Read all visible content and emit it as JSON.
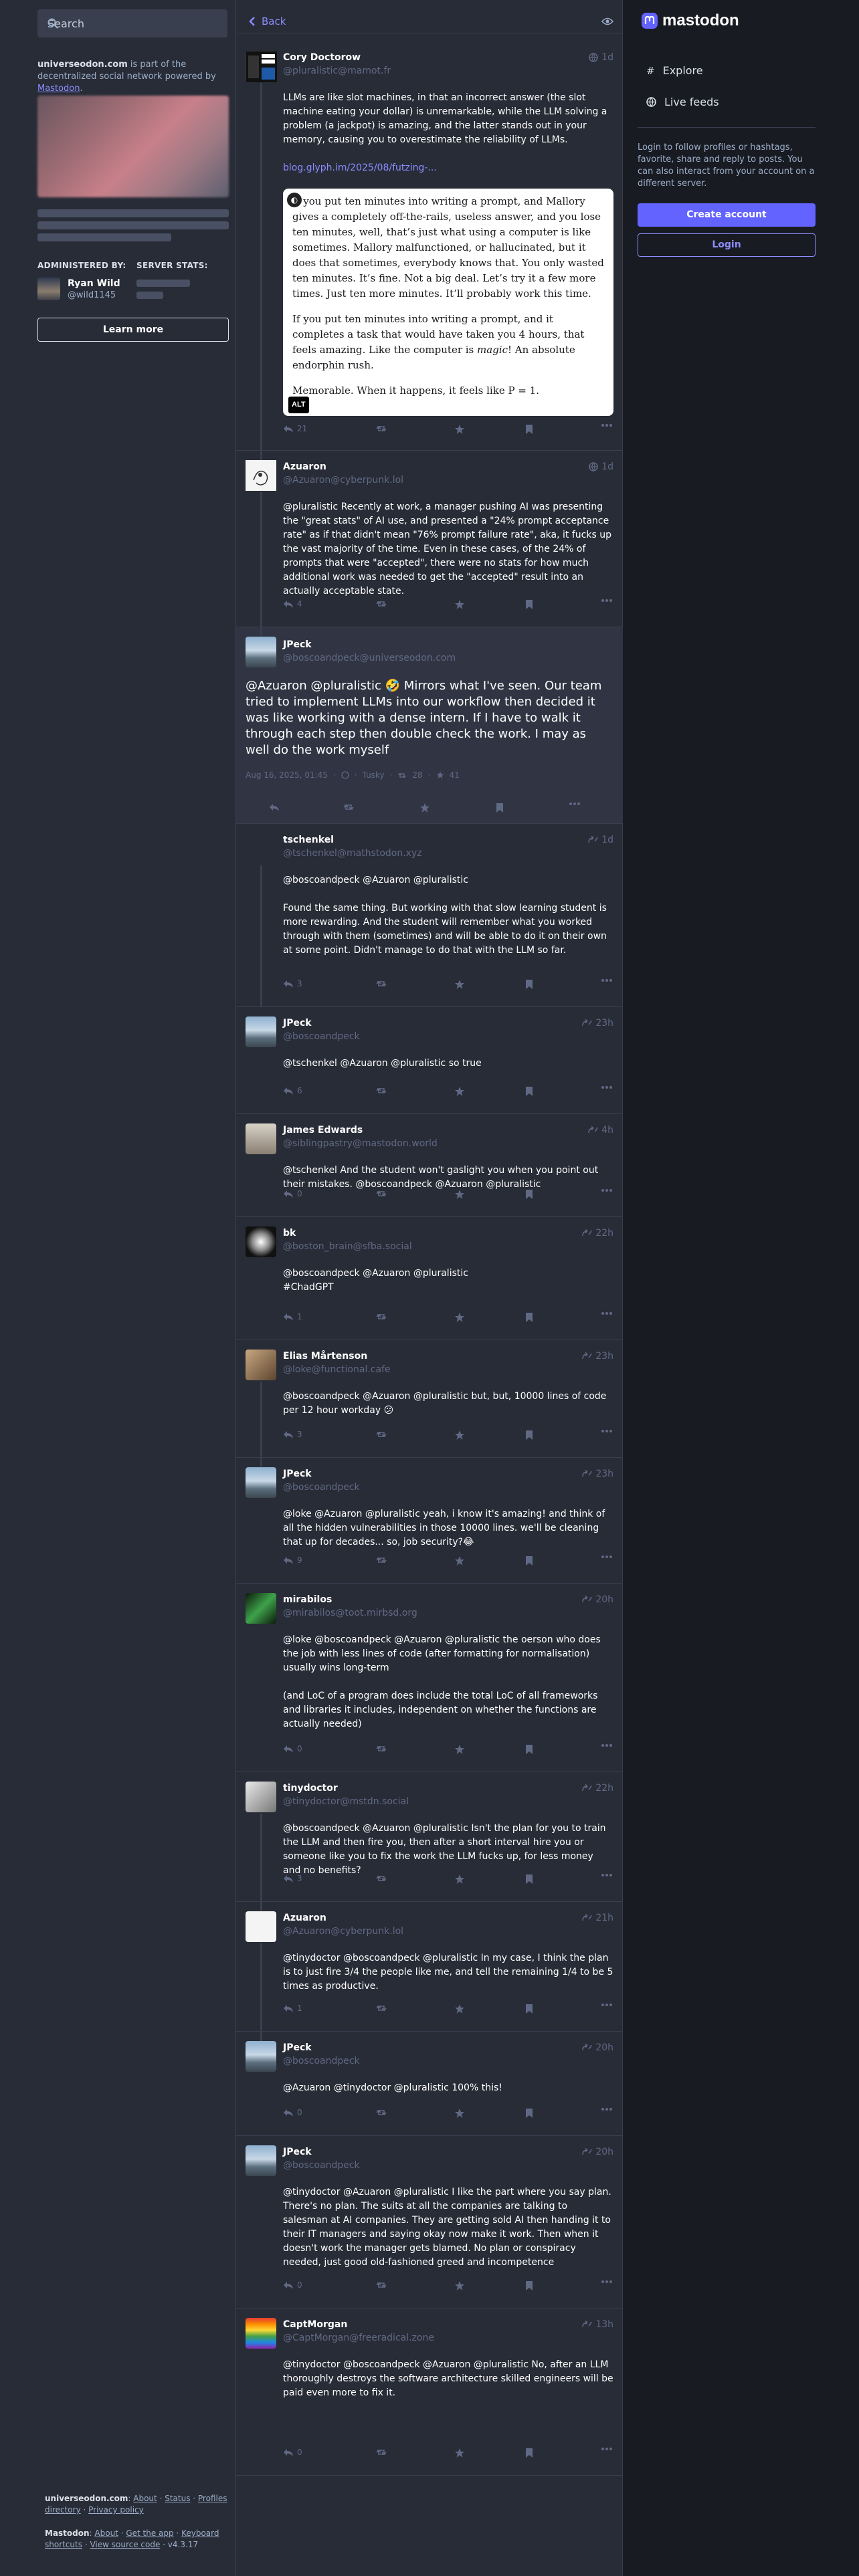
{
  "sidebar": {
    "search_placeholder": "Search",
    "about_domain": "universeodon.com",
    "about_text": " is part of the decentralized social network powered by ",
    "about_link": "Mastodon",
    "administered_by": "ADMINISTERED BY:",
    "server_stats": "SERVER STATS:",
    "admin_name": "Ryan Wild",
    "admin_acct": "@wild1145",
    "learn_more": "Learn more",
    "footer": {
      "domain": "universeodon.com",
      "links1": [
        "About",
        "Status",
        "Profiles directory",
        "Privacy policy"
      ],
      "mastodon": "Mastodon",
      "links2": [
        "About",
        "Get the app",
        "Keyboard shortcuts",
        "View source code"
      ],
      "version": "v4.3.17"
    }
  },
  "header": {
    "back": "Back"
  },
  "posts": [
    {
      "name": "Cory Doctorow",
      "acct": "@pluralistic@mamot.fr",
      "time": "1d",
      "text": "LLMs are like slot machines, in that an incorrect answer (the slot machine eating your dollar) is unremarkable, while the LLM solving a problem (a jackpot) is amazing, and the latter stands out in your memory, causing you to overestimate the reliability of LLMs.",
      "link": "blog.glyph.im/2025/08/futzing-...",
      "card_p1": "If you put ten minutes into writing a prompt, and Mallory gives a completely off-the-rails, useless answer, and you lose ten minutes, well, that’s just what using a computer is like sometimes. Mallory malfunctioned, or hallucinated, but it does that sometimes, everybody knows that. You only wasted ten minutes. It’s fine. Not a big deal. Let’s try it a few more times. Just ten more minutes. It’ll probably work this time.",
      "card_p2a": "If you put ten minutes into writing a prompt, and it completes a task that would have taken you 4 hours, that feels amazing. Like the computer is ",
      "card_p2b": "magic",
      "card_p2c": "! An absolute endorphin rush.",
      "card_p3": "Memorable. When it happens, it feels like P = 1.",
      "alt": "ALT",
      "replies": "21"
    },
    {
      "name": "Azuaron",
      "acct": "@Azuaron@cyberpunk.lol",
      "time": "1d",
      "text": "@pluralistic Recently at work, a manager pushing AI was presenting the \"great stats\" of AI use, and presented a \"24% prompt acceptance rate\" as if that didn't mean \"76% prompt failure rate\", aka, it fucks up the vast majority of the time. Even in these cases, of the 24% of prompts that were \"accepted\", there were no stats for how much additional work was needed to get the \"accepted\" result into an actually acceptable state.",
      "replies": "4"
    }
  ],
  "focused": {
    "name": "JPeck",
    "acct": "@boscoandpeck@universeodon.com",
    "text": "@Azuaron @pluralistic 🤣 Mirrors what I've seen. Our team tried to implement LLMs into our workflow then decided it was like working with a dense intern. If I have to walk it through each step then double check the work. I may as well do the work myself",
    "date": "Aug 16, 2025, 01:45",
    "app": "Tusky",
    "boosts": "28",
    "favs": "41"
  },
  "replies": [
    {
      "name": "tschenkel",
      "acct": "@tschenkel@mathstodon.xyz",
      "time": "1d",
      "count": "3",
      "text": "@boscoandpeck @Azuaron @pluralistic\n\nFound the same thing. But working with that slow learning student is more rewarding. And the student will remember what you worked through with them (sometimes) and will be able to do it on their own at some point. Didn't manage to do that with the LLM so far."
    },
    {
      "name": "JPeck",
      "acct": "@boscoandpeck",
      "time": "23h",
      "count": "6",
      "text": "@tschenkel @Azuaron @pluralistic so true"
    },
    {
      "name": "James Edwards",
      "acct": "@siblingpastry@mastodon.world",
      "time": "4h",
      "count": "0",
      "text": "@tschenkel And the student won't gaslight you when you point out their mistakes. @boscoandpeck @Azuaron @pluralistic"
    },
    {
      "name": "bk",
      "acct": "@boston_brain@sfba.social",
      "time": "22h",
      "count": "1",
      "text": "@boscoandpeck @Azuaron @pluralistic\n#ChadGPT"
    },
    {
      "name": "Elias Mårtenson",
      "acct": "@loke@functional.cafe",
      "time": "23h",
      "count": "3",
      "text": "@boscoandpeck @Azuaron @pluralistic but, but, 10000 lines of code per 12 hour workday 😕"
    },
    {
      "name": "JPeck",
      "acct": "@boscoandpeck",
      "time": "23h",
      "count": "9",
      "text": "@loke @Azuaron @pluralistic yeah, i know it's amazing! and think of all the hidden vulnerabilities in those 10000 lines. we'll be cleaning that up for decades... so, job security?😂"
    },
    {
      "name": "mirabilos",
      "acct": "@mirabilos@toot.mirbsd.org",
      "time": "20h",
      "count": "0",
      "text": "@loke @boscoandpeck @Azuaron @pluralistic the oerson who does the job with less lines of code (after formatting for normalisation) usually wins long-term\n\n(and LoC of a program does include the total LoC of all frameworks and libraries it includes, independent on whether the functions are actually needed)"
    },
    {
      "name": "tinydoctor",
      "acct": "@tinydoctor@mstdn.social",
      "time": "22h",
      "count": "3",
      "text": "@boscoandpeck @Azuaron @pluralistic Isn't the plan for you to train the LLM and then fire you, then after a short interval hire you or someone like you to fix the work the LLM fucks up, for less money and no benefits?"
    },
    {
      "name": "Azuaron",
      "acct": "@Azuaron@cyberpunk.lol",
      "time": "21h",
      "count": "1",
      "text": "@tinydoctor @boscoandpeck @pluralistic In my case, I think the plan is to just fire 3/4 the people like me, and tell the remaining 1/4 to be 5 times as productive."
    },
    {
      "name": "JPeck",
      "acct": "@boscoandpeck",
      "time": "20h",
      "count": "0",
      "text": "@Azuaron @tinydoctor @pluralistic 100% this!"
    },
    {
      "name": "JPeck",
      "acct": "@boscoandpeck",
      "time": "20h",
      "count": "0",
      "text": "@tinydoctor @Azuaron @pluralistic I like the part where you say plan. There's no plan. The suits at all the companies are talking to salesman at AI companies. They are getting sold AI then handing it to their IT managers and saying okay now make it work. Then when it doesn't work the manager gets blamed. No plan or conspiracy needed, just good old-fashioned greed and incompetence"
    },
    {
      "name": "CaptMorgan",
      "acct": "@CaptMorgan@freeradical.zone",
      "time": "13h",
      "count": "0",
      "text": "@tinydoctor @boscoandpeck @Azuaron @pluralistic No, after an LLM thoroughly destroys the software architecture skilled engineers will be paid even more to fix it."
    }
  ],
  "right": {
    "brand": "mastodon",
    "explore": "Explore",
    "live": "Live feeds",
    "info": "Login to follow profiles or hashtags, favorite, share and reply to posts. You can also interact from your account on a different server.",
    "create": "Create account",
    "login": "Login"
  }
}
